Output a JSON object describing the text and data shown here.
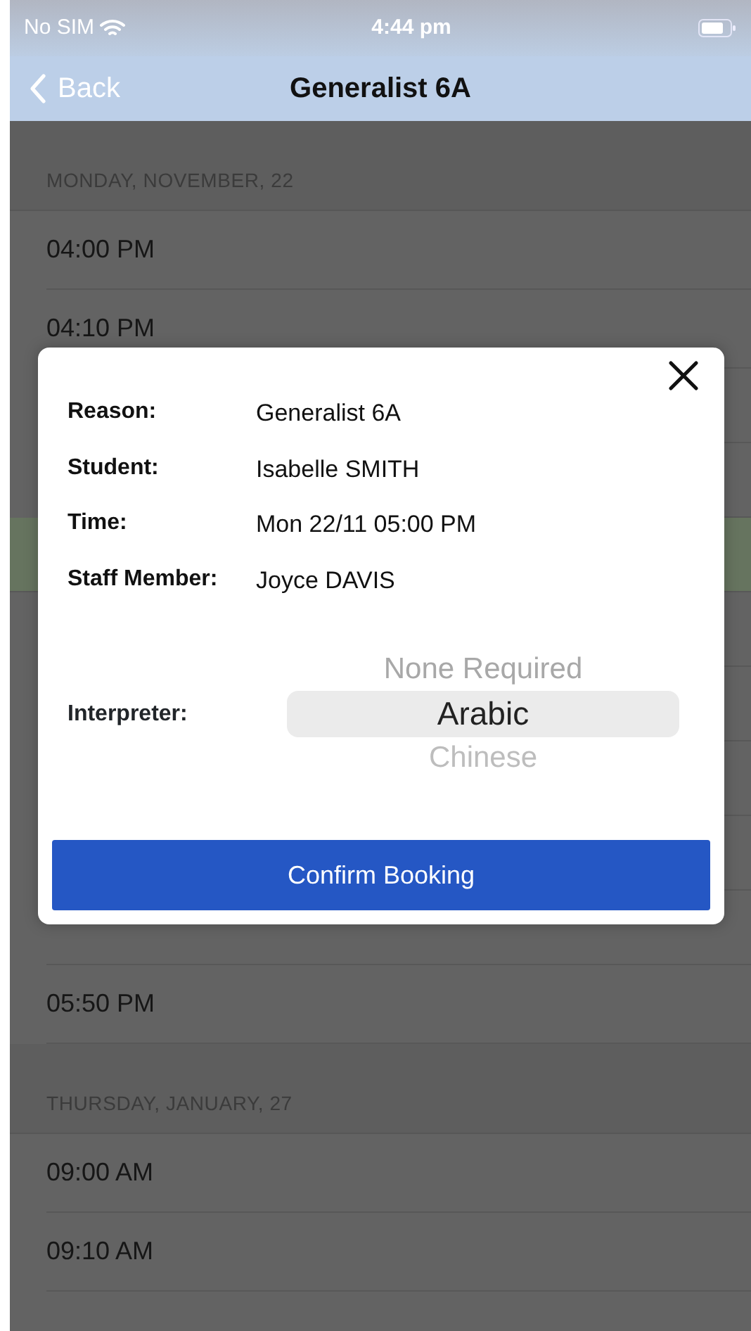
{
  "status_bar": {
    "carrier": "No SIM",
    "time": "4:44 pm"
  },
  "nav": {
    "back": "Back",
    "title": "Generalist 6A"
  },
  "sections": [
    {
      "header": "MONDAY, NOVEMBER, 22",
      "rows": [
        {
          "time": "04:00 PM",
          "selected": false
        },
        {
          "time": "04:10 PM",
          "selected": false
        },
        {
          "selected": false
        },
        {
          "selected": false
        },
        {
          "selected": true
        },
        {
          "selected": false
        },
        {
          "selected": false
        },
        {
          "selected": false
        },
        {
          "selected": false
        },
        {
          "selected": false
        },
        {
          "time": "05:50 PM",
          "selected": false
        }
      ]
    },
    {
      "header": "THURSDAY, JANUARY, 27",
      "rows": [
        {
          "time": "09:00 AM",
          "selected": false
        },
        {
          "time": "09:10 AM",
          "selected": false
        },
        {
          "selected": false
        }
      ]
    }
  ],
  "dialog": {
    "details": [
      {
        "label": "Reason:",
        "value": "Generalist 6A"
      },
      {
        "label": "Student:",
        "value": "Isabelle SMITH"
      },
      {
        "label": "Time:",
        "value": "Mon 22/11 05:00 PM"
      },
      {
        "label": "Staff Member:",
        "value": "Joyce DAVIS"
      }
    ],
    "interpreter": {
      "label": "Interpreter:",
      "options": [
        {
          "text": "None Required",
          "selected": false
        },
        {
          "text": "Arabic",
          "selected": true
        },
        {
          "text": "Chinese",
          "selected": false
        }
      ]
    },
    "confirm": "Confirm Booking"
  }
}
